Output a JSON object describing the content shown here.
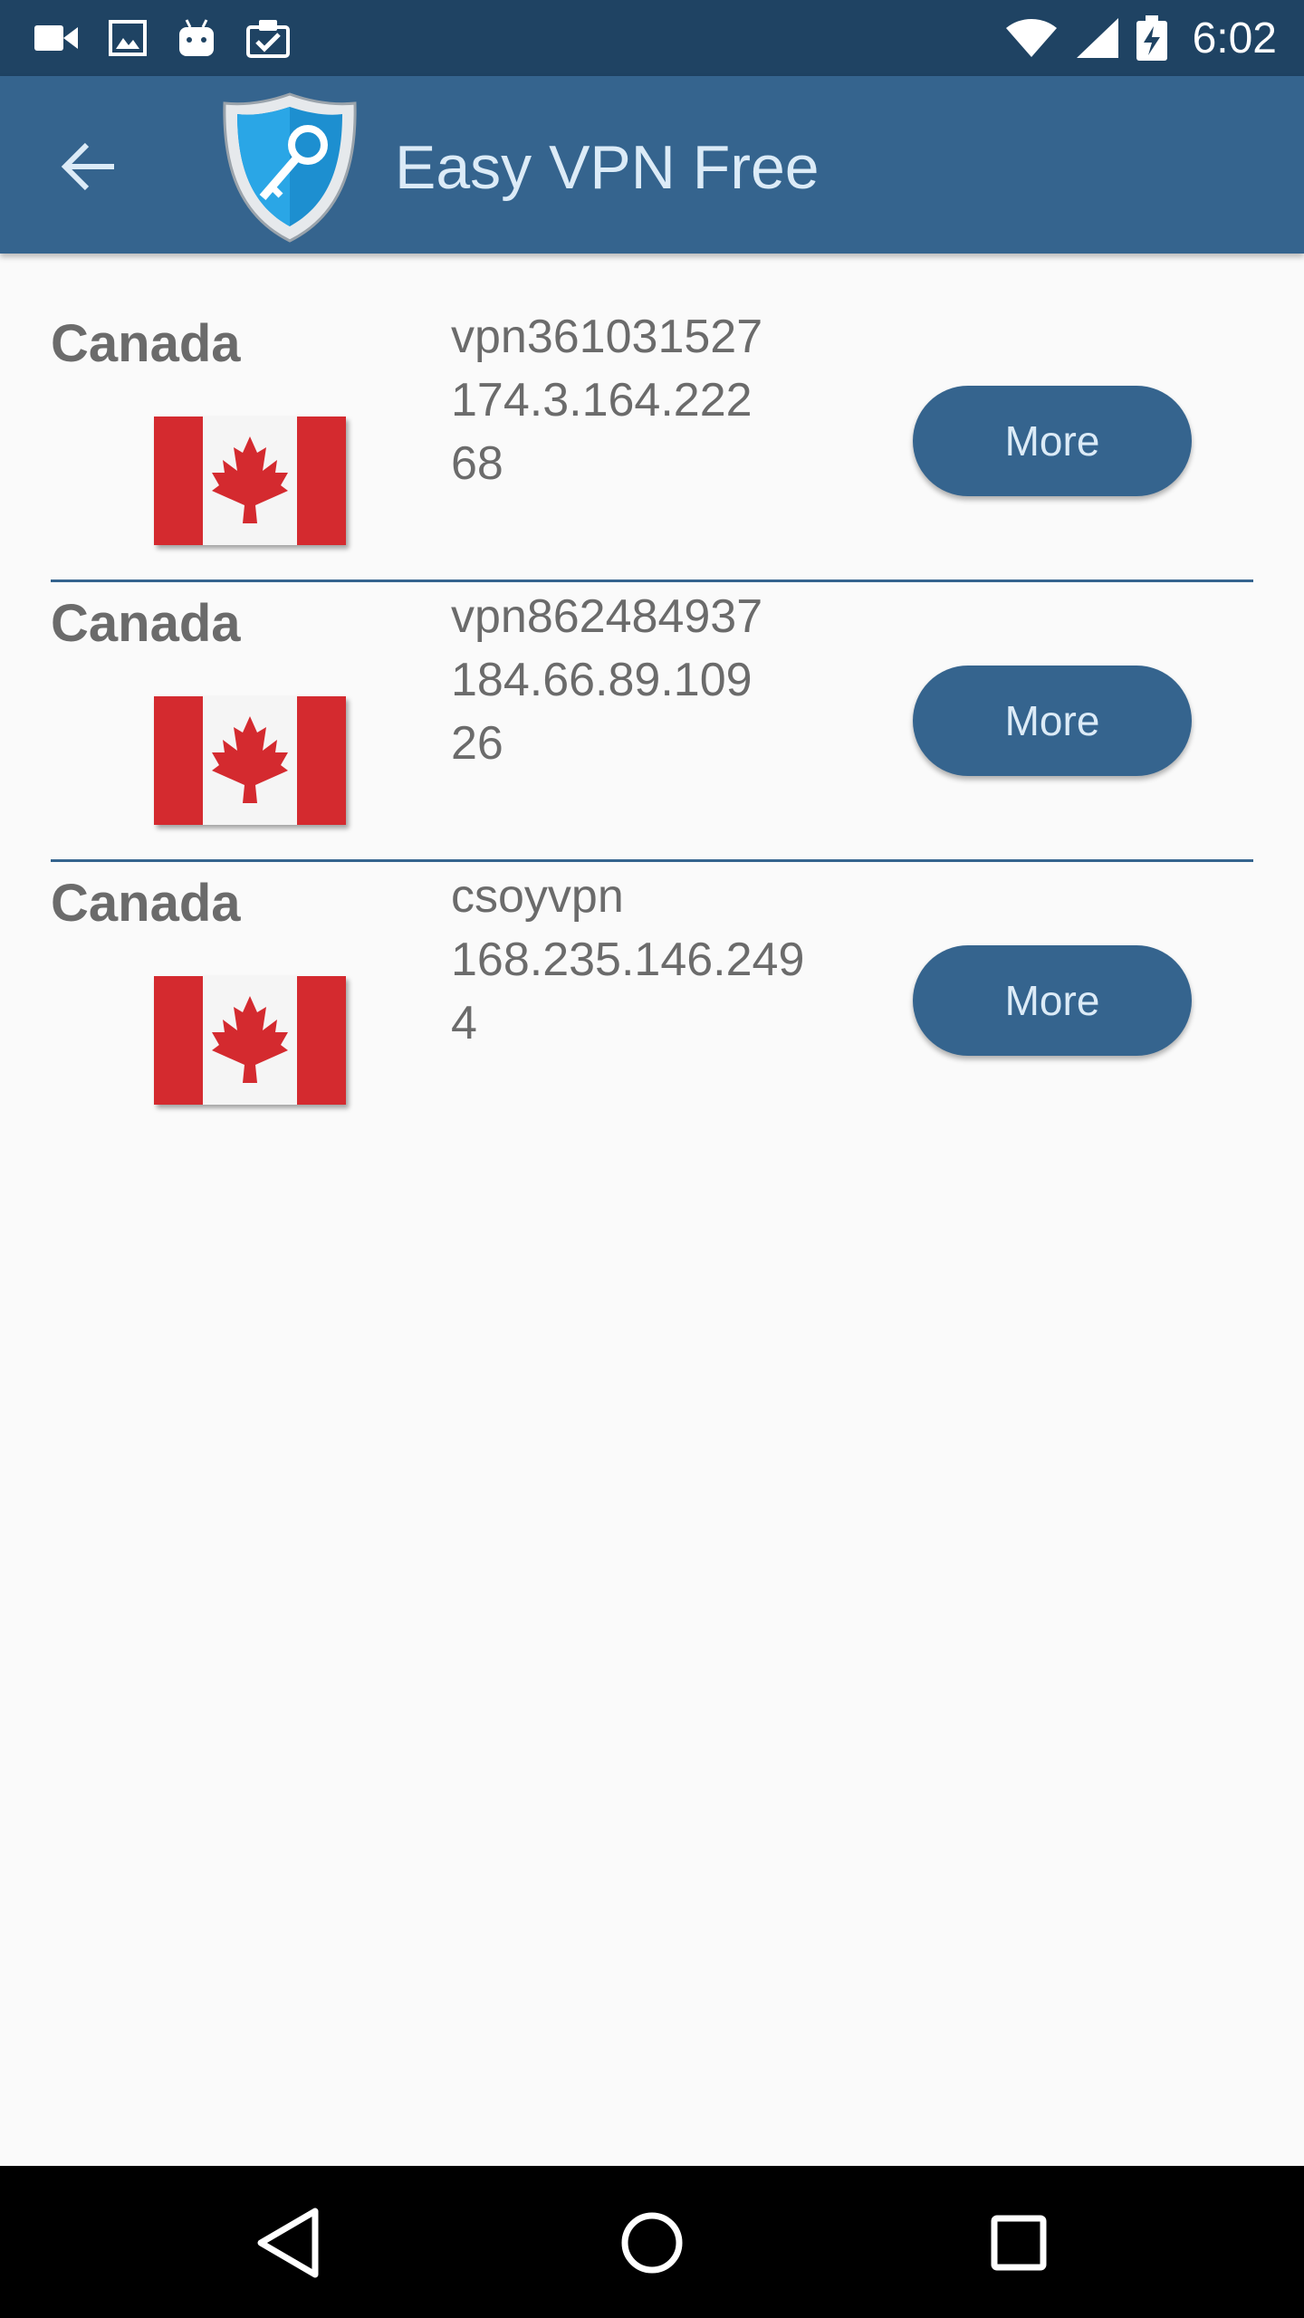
{
  "status_bar": {
    "time": "6:02",
    "left_icons": [
      "video-camera-icon",
      "image-icon",
      "android-icon",
      "clipboard-check-icon"
    ],
    "right_icons": [
      "wifi-icon",
      "cell-signal-icon",
      "battery-charging-icon"
    ]
  },
  "app_bar": {
    "title": "Easy VPN Free",
    "back_icon": "arrow-left-icon",
    "logo_icon": "shield-key-icon",
    "color": "#35648e"
  },
  "servers": [
    {
      "country": "Canada",
      "host": "vpn361031527",
      "ip": "174.3.164.222",
      "value": "68",
      "button_label": "More",
      "flag_icon": "canada-flag-icon"
    },
    {
      "country": "Canada",
      "host": "vpn862484937",
      "ip": "184.66.89.109",
      "value": "26",
      "button_label": "More",
      "flag_icon": "canada-flag-icon"
    },
    {
      "country": "Canada",
      "host": "csoyvpn",
      "ip": "168.235.146.249",
      "value": "4",
      "button_label": "More",
      "flag_icon": "canada-flag-icon"
    }
  ],
  "nav_bar": {
    "icons": [
      "back-triangle-icon",
      "home-circle-icon",
      "recents-square-icon"
    ]
  }
}
